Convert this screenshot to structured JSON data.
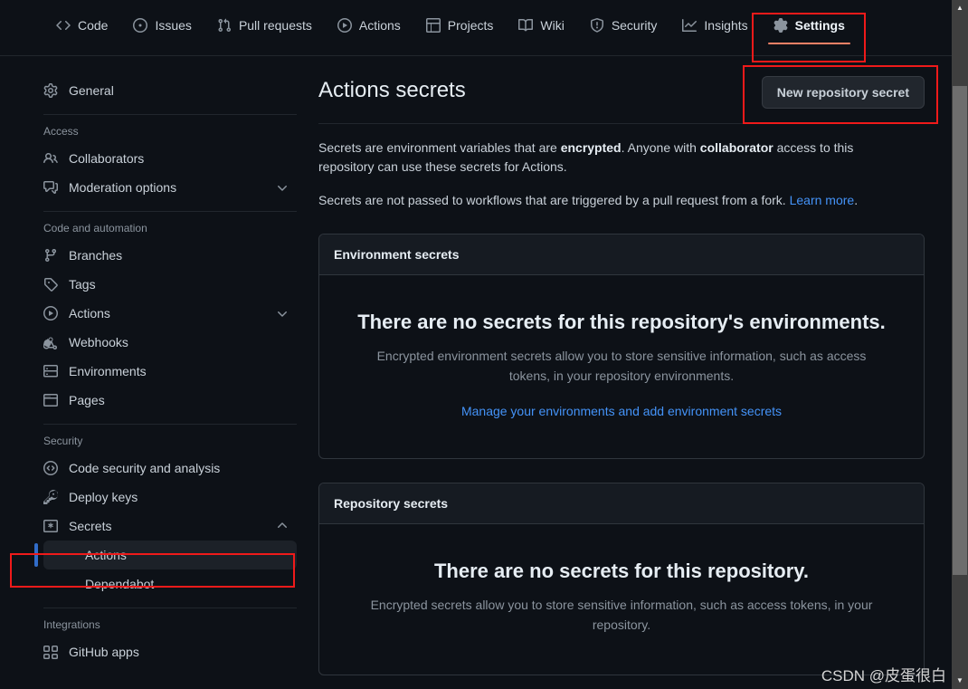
{
  "topnav": {
    "tabs": [
      {
        "label": "Code",
        "icon": "code-icon",
        "selected": false
      },
      {
        "label": "Issues",
        "icon": "issue-opened-icon",
        "selected": false
      },
      {
        "label": "Pull requests",
        "icon": "git-pull-request-icon",
        "selected": false
      },
      {
        "label": "Actions",
        "icon": "play-circle-icon",
        "selected": false
      },
      {
        "label": "Projects",
        "icon": "table-icon",
        "selected": false
      },
      {
        "label": "Wiki",
        "icon": "book-icon",
        "selected": false
      },
      {
        "label": "Security",
        "icon": "shield-icon",
        "selected": false
      },
      {
        "label": "Insights",
        "icon": "graph-icon",
        "selected": false
      },
      {
        "label": "Settings",
        "icon": "gear-icon",
        "selected": true
      }
    ]
  },
  "sidebar": {
    "general": {
      "label": "General",
      "icon": "gear-icon"
    },
    "groups": [
      {
        "title": "Access",
        "items": [
          {
            "label": "Collaborators",
            "icon": "people-icon",
            "expandable": false
          },
          {
            "label": "Moderation options",
            "icon": "comment-discussion-icon",
            "expandable": true
          }
        ]
      },
      {
        "title": "Code and automation",
        "items": [
          {
            "label": "Branches",
            "icon": "git-branch-icon",
            "expandable": false
          },
          {
            "label": "Tags",
            "icon": "tag-icon",
            "expandable": false
          },
          {
            "label": "Actions",
            "icon": "play-circle-icon",
            "expandable": true
          },
          {
            "label": "Webhooks",
            "icon": "webhook-icon",
            "expandable": false
          },
          {
            "label": "Environments",
            "icon": "server-icon",
            "expandable": false
          },
          {
            "label": "Pages",
            "icon": "browser-icon",
            "expandable": false
          }
        ]
      },
      {
        "title": "Security",
        "items": [
          {
            "label": "Code security and analysis",
            "icon": "codescan-icon",
            "expandable": false
          },
          {
            "label": "Deploy keys",
            "icon": "key-icon",
            "expandable": false
          },
          {
            "label": "Secrets",
            "icon": "key-asterisk-icon",
            "expandable": true,
            "expanded": true
          }
        ],
        "subitems": [
          {
            "label": "Actions",
            "active": true
          },
          {
            "label": "Dependabot",
            "active": false
          }
        ]
      },
      {
        "title": "Integrations",
        "items": [
          {
            "label": "GitHub apps",
            "icon": "apps-icon",
            "expandable": false
          }
        ]
      }
    ]
  },
  "main": {
    "title": "Actions secrets",
    "new_secret_button": "New repository secret",
    "description_1": {
      "part1": "Secrets are environment variables that are ",
      "bold1": "encrypted",
      "part2": ". Anyone with ",
      "bold2": "collaborator",
      "part3": " access to this repository can use these secrets for Actions."
    },
    "description_2": {
      "text": "Secrets are not passed to workflows that are triggered by a pull request from a fork. ",
      "link": "Learn more",
      "suffix": "."
    },
    "panels": [
      {
        "header": "Environment secrets",
        "blank_title": "There are no secrets for this repository's environments.",
        "blank_text": "Encrypted environment secrets allow you to store sensitive information, such as access tokens, in your repository environments.",
        "blank_link": "Manage your environments and add environment secrets"
      },
      {
        "header": "Repository secrets",
        "blank_title": "There are no secrets for this repository.",
        "blank_text": "Encrypted secrets allow you to store sensitive information, such as access tokens, in your repository.",
        "blank_link": ""
      }
    ]
  },
  "scrollbar": {
    "up_arrow": "▲",
    "down_arrow": "▼"
  },
  "watermark": "CSDN @皮蛋很白",
  "colors": {
    "background": "#0d1117",
    "panel_header": "#161b22",
    "border": "#30363d",
    "accent_selected_tab": "#f78166",
    "accent_active_item": "#316dca",
    "link": "#4493f8",
    "annotation": "#ef1a1a"
  }
}
